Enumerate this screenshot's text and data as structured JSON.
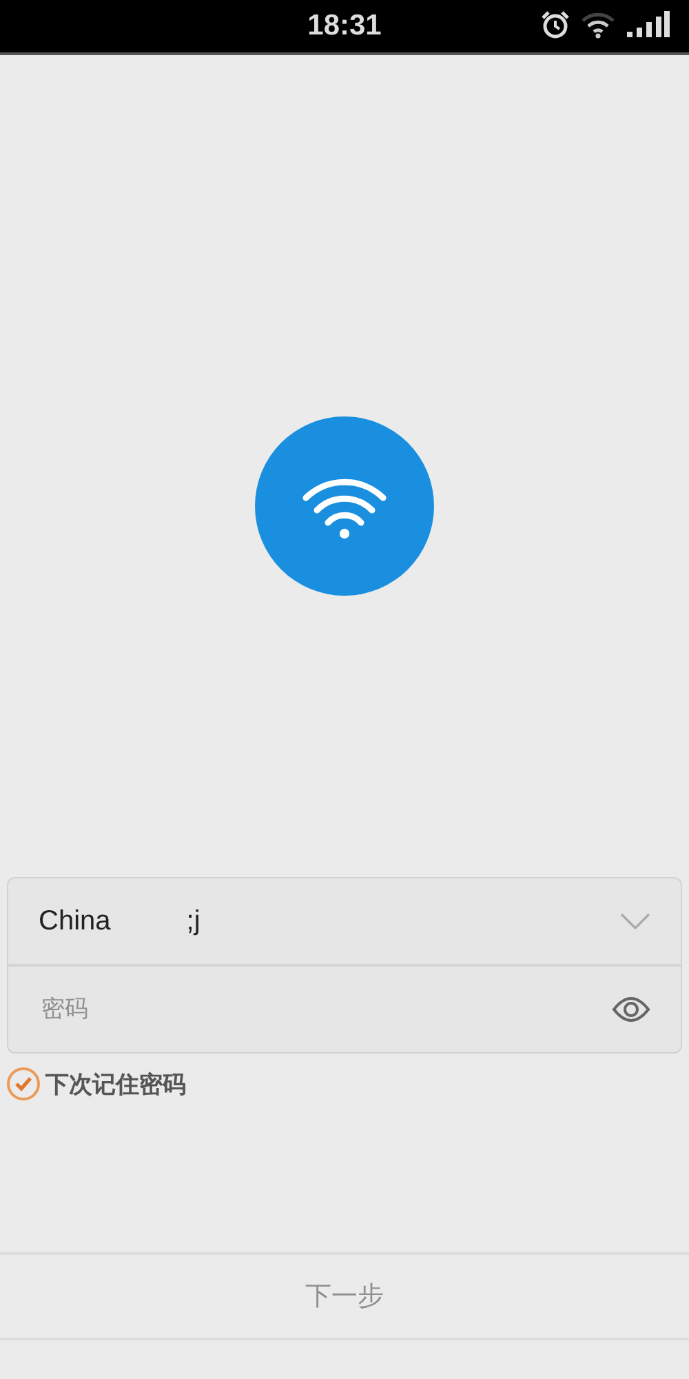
{
  "status_bar": {
    "time": "18:31",
    "alarm": true
  },
  "login_form": {
    "network": {
      "value_parts": [
        "China",
        ";j"
      ],
      "expanded": false
    },
    "password": {
      "placeholder": "密码"
    },
    "remember": {
      "label": "下次记住密码",
      "checked": true
    }
  },
  "next_button": {
    "label": "下一步",
    "disabled": true
  }
}
